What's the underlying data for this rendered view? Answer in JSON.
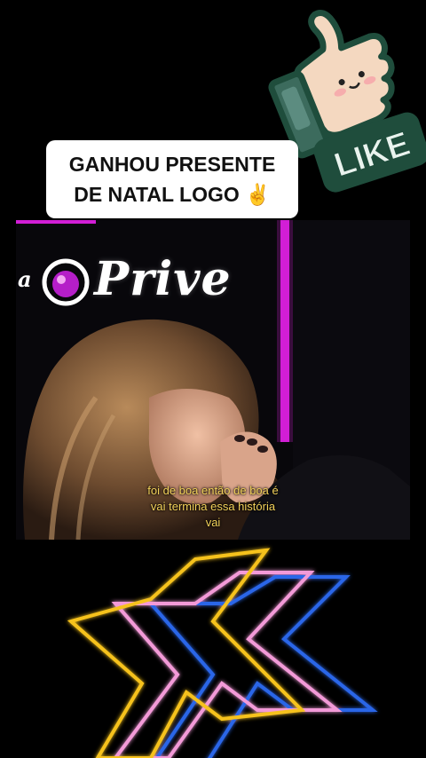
{
  "caption": {
    "line1": "GANHOU PRESENTE",
    "line2": "DE NATAL LOGO ✌️"
  },
  "sticker": {
    "label": "LIKE",
    "icon": "thumbs-up-icon"
  },
  "video": {
    "brand_partial": "a",
    "brand": "Prive",
    "subtitle_lines": [
      "foi de boa então de boa é",
      "vai termina essa história",
      "vai"
    ]
  },
  "colors": {
    "caption_bg": "#ffffff",
    "subtitle": "#f2d15a",
    "neon_magenta": "#d21ed6",
    "neon_yellow": "#f6c21b",
    "neon_pink": "#f39ad8",
    "neon_blue": "#2a66e8",
    "like_green": "#1f4d3c"
  }
}
